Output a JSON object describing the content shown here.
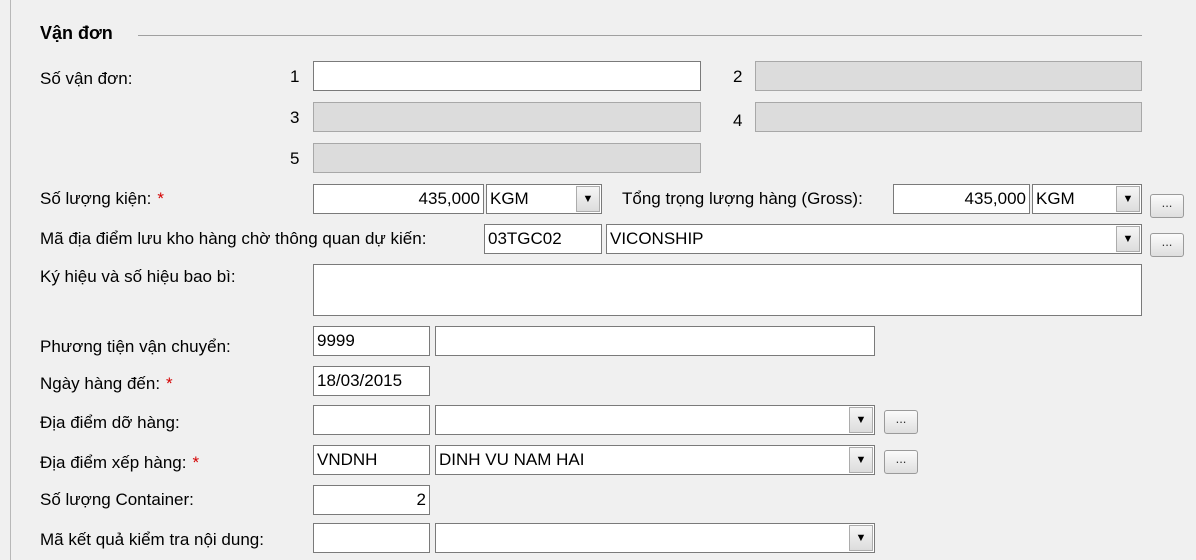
{
  "section": {
    "title": "Vận đơn"
  },
  "bill_of_lading": {
    "label": "Số vận đơn:",
    "slots": [
      {
        "num": "1",
        "value": "",
        "disabled": false
      },
      {
        "num": "2",
        "value": "",
        "disabled": true
      },
      {
        "num": "3",
        "value": "",
        "disabled": true
      },
      {
        "num": "4",
        "value": "",
        "disabled": true
      },
      {
        "num": "5",
        "value": "",
        "disabled": true
      }
    ]
  },
  "package_qty": {
    "label": "Số lượng kiện:",
    "required": "*",
    "value": "435,000",
    "unit": "KGM"
  },
  "gross_weight": {
    "label": "Tổng trọng lượng hàng (Gross):",
    "value": "435,000",
    "unit": "KGM",
    "more_label": "..."
  },
  "warehouse": {
    "label": "Mã địa điểm lưu kho hàng chờ thông quan dự kiến:",
    "code": "03TGC02",
    "name": "VICONSHIP",
    "more_label": "..."
  },
  "marks": {
    "label": "Ký hiệu và số hiệu bao bì:",
    "value": ""
  },
  "transport": {
    "label": "Phương tiện vận chuyển:",
    "code": "9999",
    "name": ""
  },
  "arrival_date": {
    "label": "Ngày hàng đến:",
    "required": "*",
    "value": "18/03/2015"
  },
  "unloading": {
    "label": "Địa điểm dỡ hàng:",
    "code": "",
    "name": "",
    "more_label": "..."
  },
  "loading": {
    "label": "Địa điểm xếp hàng:",
    "required": "*",
    "code": "VNDNH",
    "name": "DINH VU NAM HAI",
    "more_label": "..."
  },
  "container_qty": {
    "label": "Số lượng Container:",
    "value": "2"
  },
  "inspection": {
    "label": "Mã kết quả kiểm tra nội dung:",
    "code": "",
    "name": ""
  },
  "icons": {
    "dropdown": "▼"
  }
}
